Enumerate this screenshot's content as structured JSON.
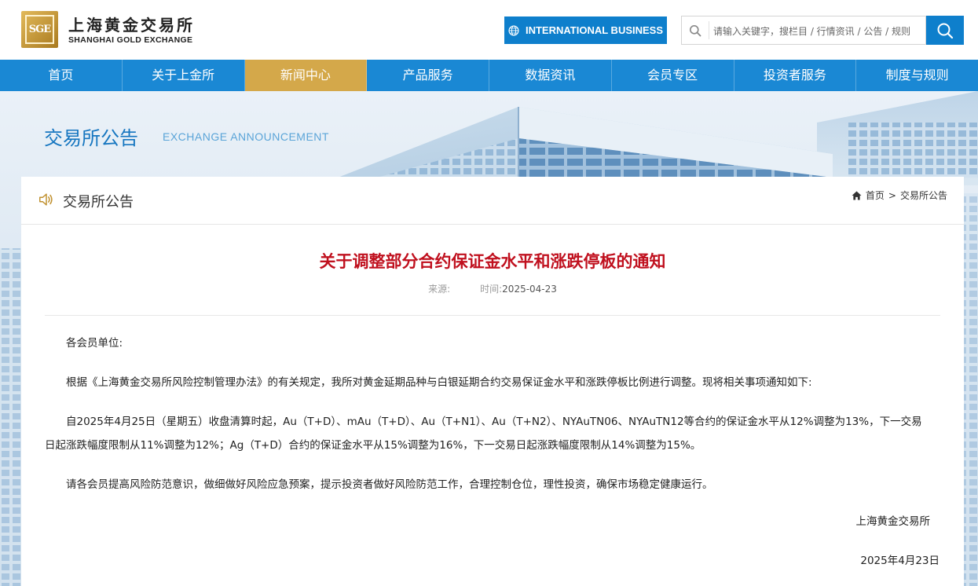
{
  "header": {
    "logo_mark": "SGE",
    "logo_cn": "上海黄金交易所",
    "logo_en": "SHANGHAI GOLD EXCHANGE",
    "intl_label": "INTERNATIONAL BUSINESS",
    "search_placeholder": "请输入关键字，搜栏目 / 行情资讯 / 公告 / 规则"
  },
  "nav": {
    "items": [
      {
        "label": "首页"
      },
      {
        "label": "关于上金所"
      },
      {
        "label": "新闻中心"
      },
      {
        "label": "产品服务"
      },
      {
        "label": "数据资讯"
      },
      {
        "label": "会员专区"
      },
      {
        "label": "投资者服务"
      },
      {
        "label": "制度与规则"
      }
    ],
    "active": "新闻中心"
  },
  "banner": {
    "title": "交易所公告",
    "subtitle": "EXCHANGE ANNOUNCEMENT"
  },
  "panel": {
    "title": "交易所公告",
    "breadcrumb": [
      {
        "label": "首页"
      },
      {
        "label": "交易所公告"
      }
    ],
    "breadcrumb_sep": ">"
  },
  "article": {
    "title": "关于调整部分合约保证金水平和涨跌停板的通知",
    "source_label": "来源:",
    "source_value": "",
    "time_label": "时间:",
    "time_value": "2025-04-23",
    "paragraphs": [
      "各会员单位:",
      "根据《上海黄金交易所风险控制管理办法》的有关规定，我所对黄金延期品种与白银延期合约交易保证金水平和涨跌停板比例进行调整。现将相关事项通知如下:",
      "自2025年4月25日（星期五）收盘清算时起，Au（T+D）、mAu（T+D）、Au（T+N1）、Au（T+N2）、NYAuTN06、NYAuTN12等合约的保证金水平从12%调整为13%，下一交易日起涨跌幅度限制从11%调整为12%；Ag（T+D）合约的保证金水平从15%调整为16%，下一交易日起涨跌幅度限制从14%调整为15%。",
      "请各会员提高风险防范意识，做细做好风险应急预案，提示投资者做好风险防范工作，合理控制仓位，理性投资，确保市场稳定健康运行。"
    ],
    "signature": "上海黄金交易所",
    "signed_date": "2025年4月23日"
  },
  "colors": {
    "brand_blue": "#1a88d4",
    "nav_active": "#d4a84a",
    "title_red": "#c0101e",
    "gold": "#c0902e"
  },
  "icons": [
    "globe-icon",
    "search-icon",
    "speaker-icon",
    "home-icon"
  ]
}
